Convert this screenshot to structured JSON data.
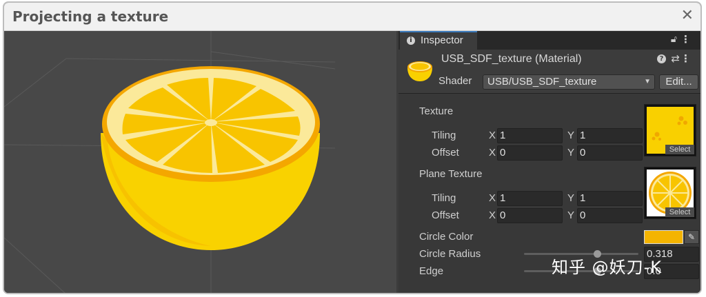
{
  "window": {
    "title": "Projecting a texture",
    "close_glyph": "✕"
  },
  "inspector": {
    "tab_label": "Inspector",
    "material_name": "USB_SDF_texture (Material)",
    "shader_label": "Shader",
    "shader_value": "USB/USB_SDF_texture",
    "edit_label": "Edit...",
    "properties": {
      "texture": {
        "label": "Texture",
        "tiling_label": "Tiling",
        "offset_label": "Offset",
        "tiling_x": "1",
        "tiling_y": "1",
        "offset_x": "0",
        "offset_y": "0",
        "select_label": "Select"
      },
      "plane_texture": {
        "label": "Plane Texture",
        "tiling_label": "Tiling",
        "offset_label": "Offset",
        "tiling_x": "1",
        "tiling_y": "1",
        "offset_x": "0",
        "offset_y": "0",
        "select_label": "Select"
      },
      "circle_color": {
        "label": "Circle Color",
        "color": "#f4b400"
      },
      "circle_radius": {
        "label": "Circle Radius",
        "value": "0.318",
        "fraction": 0.64
      },
      "edge": {
        "label": "Edge",
        "value": "0.0",
        "fraction": 0.64
      }
    },
    "axis_x": "X",
    "axis_y": "Y"
  },
  "watermark": "知乎 @妖刀-K",
  "colors": {
    "accent": "#3a79bb",
    "lemon": "#f9d000",
    "rind": "#f6a800"
  }
}
